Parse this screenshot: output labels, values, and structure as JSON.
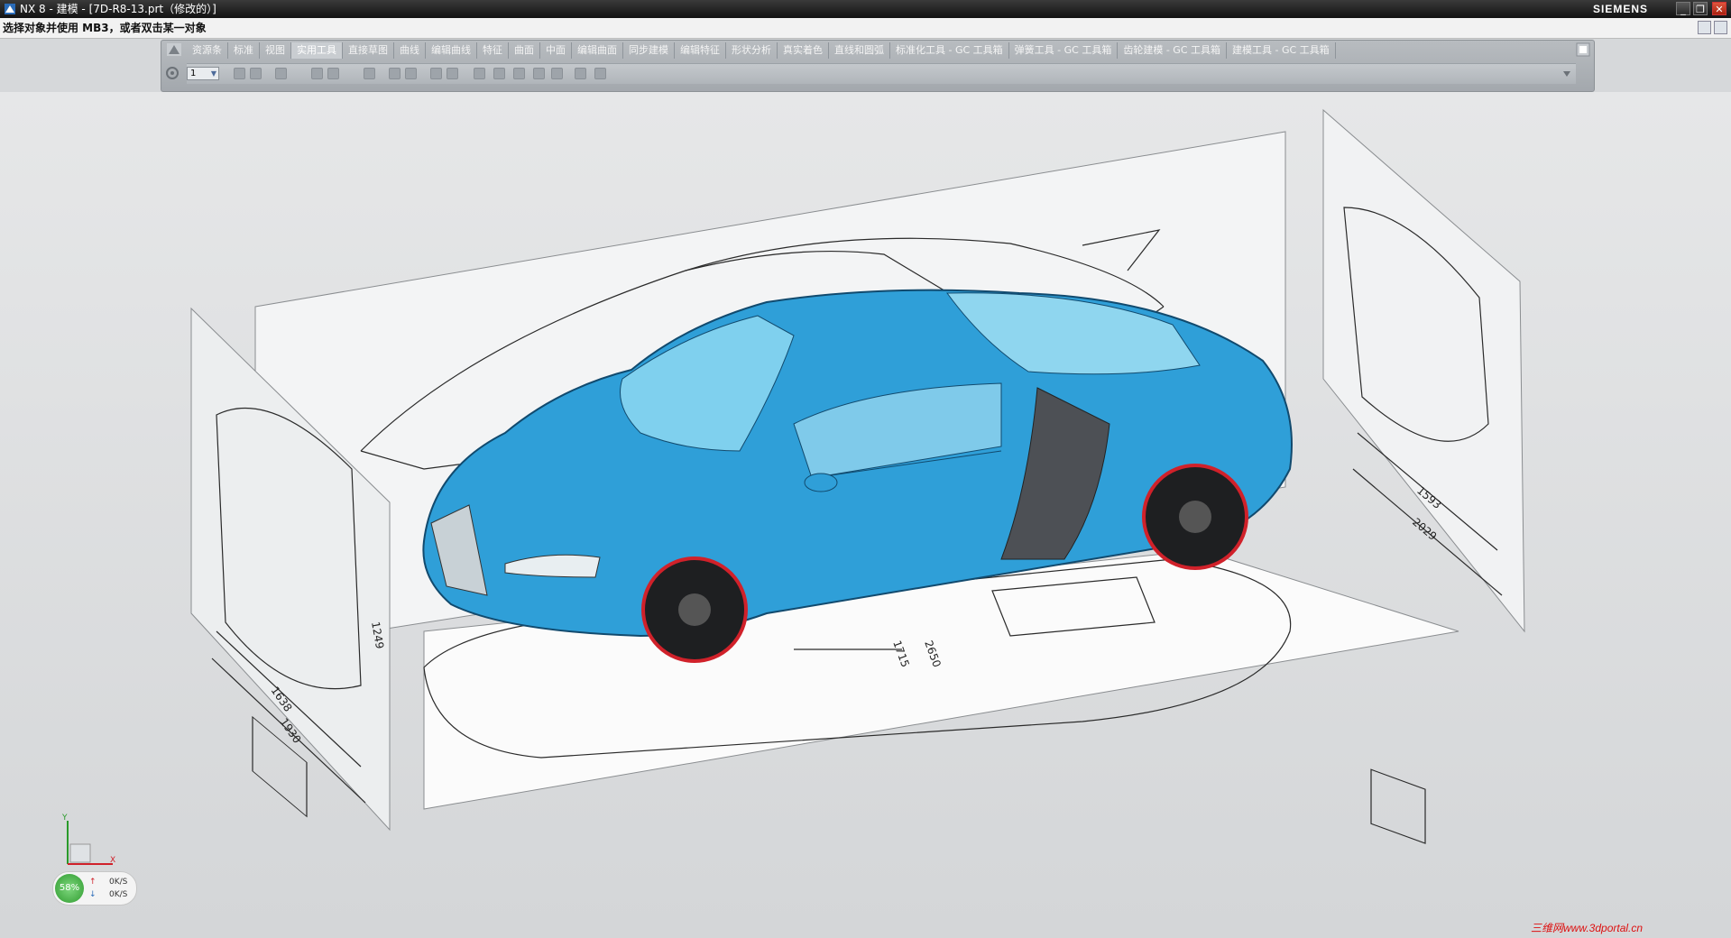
{
  "titlebar": {
    "title": "NX 8 - 建模 - [7D-R8-13.prt（修改的）]",
    "brand": "SIEMENS",
    "minimize_icon": "window-minimize-icon",
    "restore_icon": "window-restore-icon",
    "close_icon": "window-close-icon"
  },
  "cue_line": {
    "text": "选择对象并使用 MB3，或者双击某一对象"
  },
  "ribbon": {
    "tabs": [
      {
        "label": "资源条"
      },
      {
        "label": "标准"
      },
      {
        "label": "视图"
      },
      {
        "label": "实用工具"
      },
      {
        "label": "直接草图"
      },
      {
        "label": "曲线"
      },
      {
        "label": "编辑曲线"
      },
      {
        "label": "特征"
      },
      {
        "label": "曲面"
      },
      {
        "label": "中面"
      },
      {
        "label": "编辑曲面"
      },
      {
        "label": "同步建模"
      },
      {
        "label": "编辑特征"
      },
      {
        "label": "形状分析"
      },
      {
        "label": "真实着色"
      },
      {
        "label": "直线和圆弧"
      },
      {
        "label": "标准化工具 - GC 工具箱"
      },
      {
        "label": "弹簧工具 - GC 工具箱"
      },
      {
        "label": "齿轮建模 - GC 工具箱"
      },
      {
        "label": "建模工具 - GC 工具箱"
      }
    ],
    "active_tab": "实用工具",
    "layer_value": "1"
  },
  "network": {
    "percent": "58%",
    "upload": "0K/S",
    "download": "0K/S"
  },
  "triad": {
    "x_label": "X",
    "y_label": "Y"
  },
  "dimensions": {
    "front_height": "1249",
    "front_width_a": "1638",
    "front_width_b": "1930",
    "rear_width_a": "1593",
    "rear_width_b": "2029",
    "bottom_length_a": "1715",
    "bottom_length_b": "2650"
  },
  "watermark": "三维网www.3dportal.cn",
  "colors": {
    "car_body": "#2f9fd8",
    "titlebar": "#1b1b1b",
    "viewport": "#dcdedf",
    "accent_wheel_rim": "#d0212a"
  }
}
